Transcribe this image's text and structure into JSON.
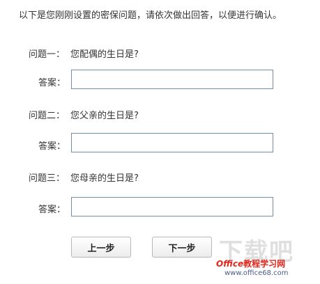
{
  "intro": "以下是您刚刚设置的密保问题，请依次做出回答，以便进行确认。",
  "questions": [
    {
      "label": "问题一：",
      "text": "您配偶的生日是?",
      "answer_label": "答案：",
      "answer_value": ""
    },
    {
      "label": "问题二：",
      "text": "您父亲的生日是?",
      "answer_label": "答案：",
      "answer_value": ""
    },
    {
      "label": "问题三：",
      "text": "您母亲的生日是?",
      "answer_label": "答案：",
      "answer_value": ""
    }
  ],
  "buttons": {
    "prev": "上一步",
    "next": "下一步"
  },
  "watermark": {
    "big": "下载吧",
    "brand_office": "Office",
    "brand_rest": "教程学习网",
    "url": "www.office68.com"
  }
}
